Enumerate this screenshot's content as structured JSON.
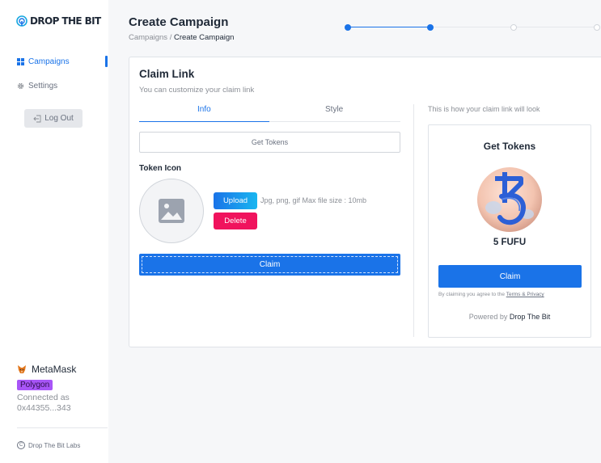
{
  "brand": {
    "name": "DROP THE BIT",
    "footer": "Drop The Bit Labs",
    "accent": "#1a73e8"
  },
  "sidebar": {
    "items": [
      {
        "label": "Campaigns",
        "icon": "grid-icon",
        "active": true
      },
      {
        "label": "Settings",
        "icon": "gear-icon",
        "active": false
      }
    ],
    "logout_label": "Log Out"
  },
  "wallet": {
    "name": "MetaMask",
    "network": "Polygon",
    "connected_label": "Connected as",
    "address": "0x44355...343"
  },
  "header": {
    "title": "Create Campaign",
    "breadcrumb": {
      "parent": "Campaigns",
      "separator": "/",
      "current": "Create Campaign"
    },
    "stepper": {
      "total_steps": 4,
      "current_step": 2
    }
  },
  "form": {
    "title": "Claim Link",
    "subtitle": "You can customize your claim link",
    "tabs": [
      {
        "label": "Info"
      },
      {
        "label": "Style"
      }
    ],
    "active_tab": "Info",
    "title_input_value": "Get Tokens",
    "token_icon_label": "Token Icon",
    "upload_label": "Upload",
    "delete_label": "Delete",
    "file_hint": "Jpg, png, gif Max file size : 10mb",
    "claim_label": "Claim"
  },
  "preview": {
    "hint": "This is how your claim link will look",
    "title": "Get Tokens",
    "token_icon": "tezos-logo-icon",
    "amount": "5 FUFU",
    "claim_label": "Claim",
    "terms_prefix": "By claiming you agree to the",
    "terms_link": "Terms & Privacy",
    "powered_prefix": "Powered by",
    "powered_brand": "Drop The Bit"
  },
  "colors": {
    "accent": "#1a73e8",
    "delete": "#f0135d",
    "network_badge": "#a855f7"
  }
}
